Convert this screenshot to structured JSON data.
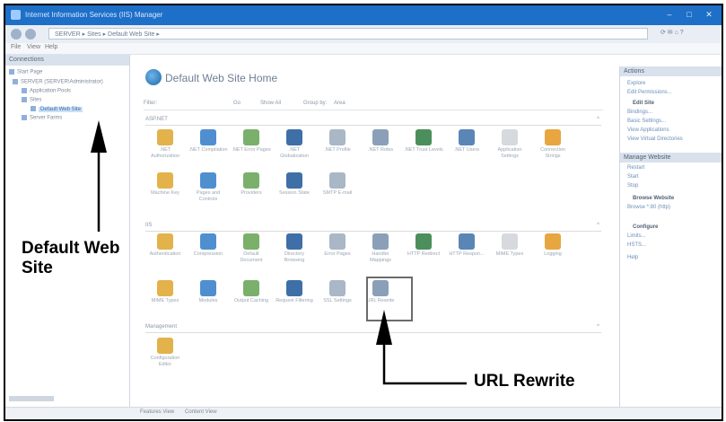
{
  "window": {
    "title": "Internet Information Services (IIS) Manager"
  },
  "address": {
    "path": "SERVER ▸ Sites ▸ Default Web Site ▸"
  },
  "menu": [
    "File",
    "View",
    "Help"
  ],
  "connections": {
    "header": "Connections",
    "tree": [
      "Start Page",
      "SERVER (SERVER\\Administrator)",
      "Application Pools",
      "Sites",
      "Default Web Site",
      "Server Farms"
    ]
  },
  "main": {
    "title": "Default Web Site Home",
    "filter": {
      "label": "Filter:",
      "go": "Go",
      "show_all": "Show All",
      "group_by": "Group by:",
      "group_value": "Area"
    },
    "sections": [
      "ASP.NET",
      "IIS",
      "Management"
    ],
    "aspnet_row1": [
      ".NET Authorization",
      ".NET Compilation",
      ".NET Error Pages",
      ".NET Globalization",
      ".NET Profile",
      ".NET Roles",
      ".NET Trust Levels",
      ".NET Users",
      "Application Settings",
      "Connection Strings"
    ],
    "aspnet_row2": [
      "Machine Key",
      "Pages and Controls",
      "Providers",
      "Session State",
      "SMTP E-mail"
    ],
    "iis_row1": [
      "Authentication",
      "Compression",
      "Default Document",
      "Directory Browsing",
      "Error Pages",
      "Handler Mappings",
      "HTTP Redirect",
      "HTTP Respon...",
      "MIME Types",
      "Logging"
    ],
    "iis_row2": [
      "MIME Types",
      "Modules",
      "Output Caching",
      "Request Filtering",
      "SSL Settings",
      "URL Rewrite"
    ],
    "mgmt_row": [
      "Configuration Editor"
    ]
  },
  "actions": {
    "header": "Actions",
    "items": [
      "Explore",
      "Edit Permissions...",
      "Edit Site",
      "Bindings...",
      "Basic Settings...",
      "View Applications",
      "View Virtual Directories"
    ],
    "manage_header": "Manage Website",
    "manage_items": [
      "Restart",
      "Start",
      "Stop"
    ],
    "browse_header": "Browse Website",
    "browse_items": [
      "Browse *:80 (http)"
    ],
    "configure_header": "Configure",
    "configure_items": [
      "Limits...",
      "HSTS..."
    ],
    "help": "Help"
  },
  "status": {
    "features_view": "Features View",
    "content_view": "Content View"
  },
  "annotations": {
    "default_web_site": "Default Web\nSite",
    "url_rewrite": "URL Rewrite"
  },
  "colors": {
    "titlebar": "#1e6fc7",
    "selection": "#cde1f7",
    "link": "#6c8fb8"
  }
}
